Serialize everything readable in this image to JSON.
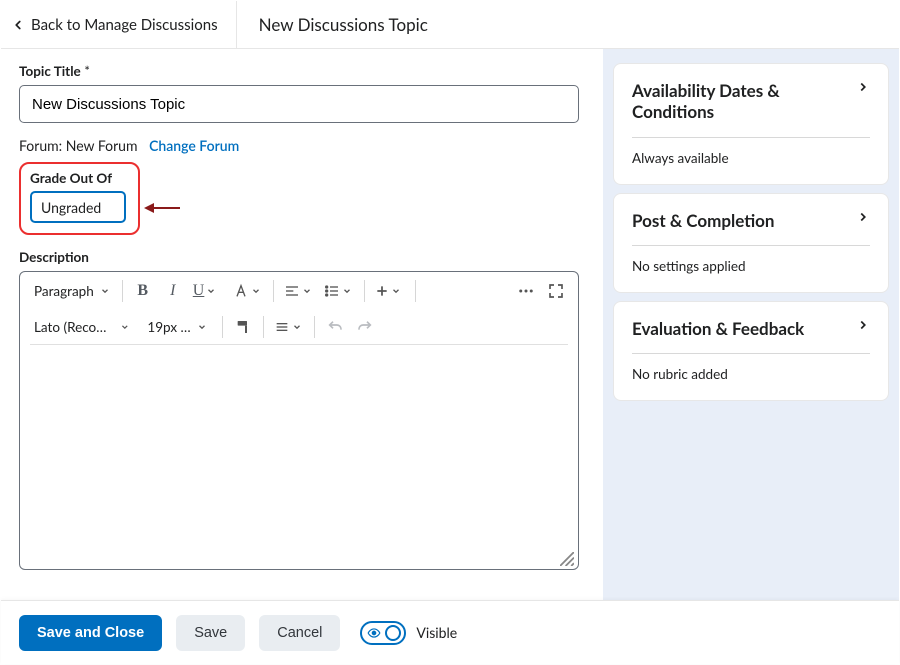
{
  "header": {
    "back_label": "Back to Manage Discussions",
    "page_title": "New Discussions Topic"
  },
  "main": {
    "title_label": "Topic Title",
    "title_value": "New Discussions Topic",
    "forum_prefix": "Forum: ",
    "forum_name": "New Forum",
    "change_forum": "Change Forum",
    "grade_label": "Grade Out Of",
    "grade_value": "Ungraded",
    "description_label": "Description",
    "editor": {
      "block_format": "Paragraph",
      "font_family": "Lato (Recom…",
      "font_size": "19px …"
    }
  },
  "side_panels": [
    {
      "title": "Availability Dates & Conditions",
      "subtitle": "Always available"
    },
    {
      "title": "Post & Completion",
      "subtitle": "No settings applied"
    },
    {
      "title": "Evaluation & Feedback",
      "subtitle": "No rubric added"
    }
  ],
  "footer": {
    "save_close": "Save and Close",
    "save": "Save",
    "cancel": "Cancel",
    "visibility_label": "Visible"
  }
}
